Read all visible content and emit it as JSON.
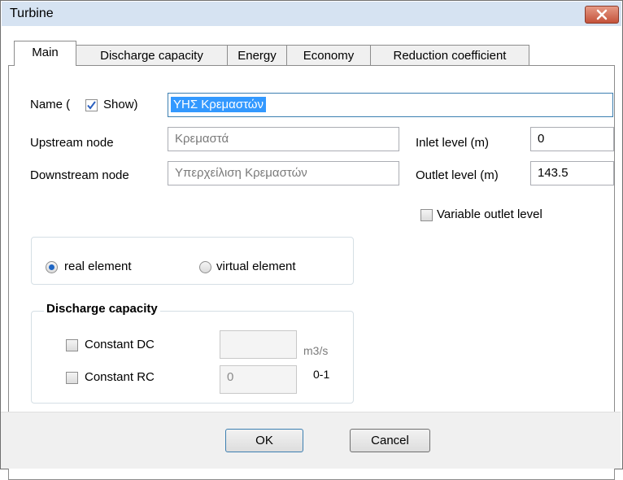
{
  "window": {
    "title": "Turbine"
  },
  "tabs": [
    {
      "label": "Main",
      "active": true
    },
    {
      "label": "Discharge capacity",
      "active": false
    },
    {
      "label": "Energy",
      "active": false
    },
    {
      "label": "Economy",
      "active": false
    },
    {
      "label": "Reduction coefficient",
      "active": false
    }
  ],
  "form": {
    "name_label_prefix": "Name (",
    "show_label": "Show)",
    "show_checked": true,
    "name_value": "ΥΗΣ Κρεμαστών",
    "upstream_label": "Upstream node",
    "upstream_value": "Κρεμαστά",
    "downstream_label": "Downstream node",
    "downstream_value": "Υπερχείλιση Κρεμαστών",
    "inlet_label": "Inlet level (m)",
    "inlet_value": "0",
    "outlet_label": "Outlet level (m)",
    "outlet_value": "143.5",
    "variable_outlet_label": "Variable outlet level",
    "variable_outlet_checked": false
  },
  "element_type": {
    "real_label": "real element",
    "virtual_label": "virtual element",
    "selected": "real element"
  },
  "discharge": {
    "group_title": "Discharge capacity",
    "constant_dc_label": "Constant DC",
    "constant_dc_checked": false,
    "dc_value": "",
    "dc_unit": "m3/s",
    "constant_rc_label": "Constant RC",
    "constant_rc_checked": false,
    "rc_value": "0",
    "rc_unit": "0-1"
  },
  "buttons": {
    "ok": "OK",
    "cancel": "Cancel"
  },
  "colors": {
    "titlebar": "#d6e3f2",
    "close_button": "#c75a43",
    "selection": "#3399ff",
    "accent": "#2a5fbf"
  }
}
